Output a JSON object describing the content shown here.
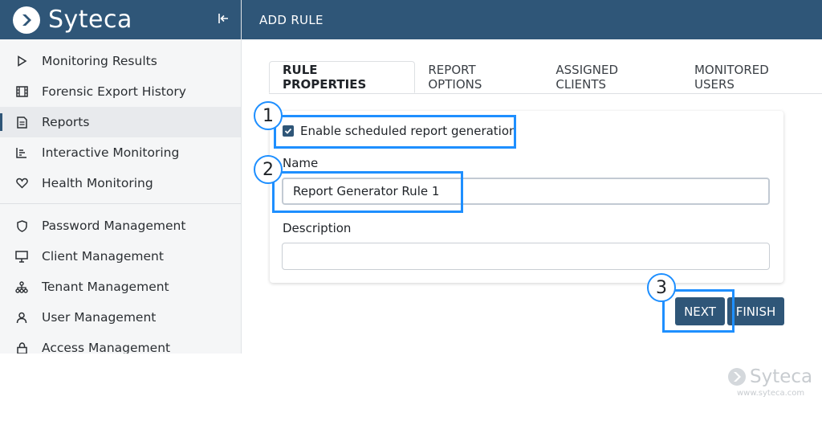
{
  "brand": {
    "name": "Syteca"
  },
  "topbar": {
    "title": "ADD RULE"
  },
  "sidebar": {
    "group1": [
      {
        "label": "Monitoring Results",
        "icon": "play-icon",
        "active": false
      },
      {
        "label": "Forensic Export History",
        "icon": "film-icon",
        "active": false
      },
      {
        "label": "Reports",
        "icon": "document-icon",
        "active": true
      },
      {
        "label": "Interactive Monitoring",
        "icon": "bar-list-icon",
        "active": false
      },
      {
        "label": "Health Monitoring",
        "icon": "heart-icon",
        "active": false
      }
    ],
    "group2": [
      {
        "label": "Password Management",
        "icon": "shield-icon"
      },
      {
        "label": "Client Management",
        "icon": "monitor-icon"
      },
      {
        "label": "Tenant Management",
        "icon": "hierarchy-icon"
      },
      {
        "label": "User Management",
        "icon": "user-icon"
      },
      {
        "label": "Access Management",
        "icon": "lock-icon"
      }
    ]
  },
  "tabs": [
    {
      "label": "RULE PROPERTIES",
      "active": true
    },
    {
      "label": "REPORT OPTIONS",
      "active": false
    },
    {
      "label": "ASSIGNED CLIENTS",
      "active": false
    },
    {
      "label": "MONITORED USERS",
      "active": false
    }
  ],
  "form": {
    "enable_label": "Enable scheduled report generation",
    "enable_checked": true,
    "name_label": "Name",
    "name_value": "Report Generator Rule 1",
    "description_label": "Description",
    "description_value": ""
  },
  "buttons": {
    "next": "NEXT",
    "finish": "FINISH"
  },
  "callouts": [
    "1",
    "2",
    "3"
  ],
  "watermark": {
    "name": "Syteca",
    "url": "www.syteca.com"
  },
  "colors": {
    "primary": "#2f5678",
    "callout": "#1e8fff",
    "active_bg": "#e8eaed"
  }
}
